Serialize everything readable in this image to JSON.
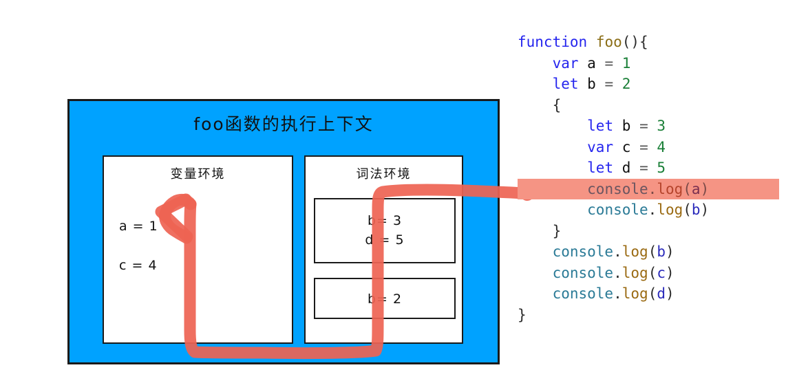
{
  "diagram": {
    "title": "foo函数的执行上下文",
    "variable_environment": {
      "title": "变量环境",
      "entries": [
        "a = 1",
        "c = 4"
      ]
    },
    "lexical_environment": {
      "title": "词法环境",
      "scopes": [
        {
          "lines": [
            "b= 3",
            "d = 5"
          ]
        },
        {
          "lines": [
            "b= 2"
          ]
        }
      ]
    },
    "colors": {
      "context_background": "#00A2FF",
      "box_border": "#1a1a1a",
      "annotation": "#EE6352",
      "highlight": "#F59484"
    }
  },
  "code": {
    "lines": [
      {
        "indent": 0,
        "highlight": false,
        "tokens": [
          {
            "t": "function",
            "c": "kw"
          },
          {
            "t": " ",
            "c": "punct"
          },
          {
            "t": "foo",
            "c": "fnname"
          },
          {
            "t": "(){",
            "c": "brace"
          }
        ]
      },
      {
        "indent": 1,
        "highlight": false,
        "tokens": [
          {
            "t": "var",
            "c": "kw"
          },
          {
            "t": " ",
            "c": "punct"
          },
          {
            "t": "a",
            "c": "var"
          },
          {
            "t": " ",
            "c": "punct"
          },
          {
            "t": "=",
            "c": "op"
          },
          {
            "t": " ",
            "c": "punct"
          },
          {
            "t": "1",
            "c": "num"
          }
        ]
      },
      {
        "indent": 1,
        "highlight": false,
        "tokens": [
          {
            "t": "let",
            "c": "kw"
          },
          {
            "t": " ",
            "c": "punct"
          },
          {
            "t": "b",
            "c": "var"
          },
          {
            "t": " ",
            "c": "punct"
          },
          {
            "t": "=",
            "c": "op"
          },
          {
            "t": " ",
            "c": "punct"
          },
          {
            "t": "2",
            "c": "num"
          }
        ]
      },
      {
        "indent": 1,
        "highlight": false,
        "tokens": [
          {
            "t": "{",
            "c": "brace"
          }
        ]
      },
      {
        "indent": 2,
        "highlight": false,
        "tokens": [
          {
            "t": "let",
            "c": "kw"
          },
          {
            "t": " ",
            "c": "punct"
          },
          {
            "t": "b",
            "c": "var"
          },
          {
            "t": " ",
            "c": "punct"
          },
          {
            "t": "=",
            "c": "op"
          },
          {
            "t": " ",
            "c": "punct"
          },
          {
            "t": "3",
            "c": "num"
          }
        ]
      },
      {
        "indent": 2,
        "highlight": false,
        "tokens": [
          {
            "t": "var",
            "c": "kw"
          },
          {
            "t": " ",
            "c": "punct"
          },
          {
            "t": "c",
            "c": "var"
          },
          {
            "t": " ",
            "c": "punct"
          },
          {
            "t": "=",
            "c": "op"
          },
          {
            "t": " ",
            "c": "punct"
          },
          {
            "t": "4",
            "c": "num"
          }
        ]
      },
      {
        "indent": 2,
        "highlight": false,
        "tokens": [
          {
            "t": "let",
            "c": "kw"
          },
          {
            "t": " ",
            "c": "punct"
          },
          {
            "t": "d",
            "c": "var"
          },
          {
            "t": " ",
            "c": "punct"
          },
          {
            "t": "=",
            "c": "op"
          },
          {
            "t": " ",
            "c": "punct"
          },
          {
            "t": "5",
            "c": "num"
          }
        ]
      },
      {
        "indent": 2,
        "highlight": true,
        "tokens": [
          {
            "t": "console",
            "c": "obj"
          },
          {
            "t": ".",
            "c": "punct"
          },
          {
            "t": "log",
            "c": "fn"
          },
          {
            "t": "(",
            "c": "punct"
          },
          {
            "t": "a",
            "c": "arg"
          },
          {
            "t": ")",
            "c": "punct"
          }
        ]
      },
      {
        "indent": 2,
        "highlight": false,
        "tokens": [
          {
            "t": "console",
            "c": "obj"
          },
          {
            "t": ".",
            "c": "punct"
          },
          {
            "t": "log",
            "c": "fn"
          },
          {
            "t": "(",
            "c": "punct"
          },
          {
            "t": "b",
            "c": "arg"
          },
          {
            "t": ")",
            "c": "punct"
          }
        ]
      },
      {
        "indent": 1,
        "highlight": false,
        "tokens": [
          {
            "t": "}",
            "c": "brace"
          }
        ]
      },
      {
        "indent": 1,
        "highlight": false,
        "tokens": [
          {
            "t": "console",
            "c": "obj"
          },
          {
            "t": ".",
            "c": "punct"
          },
          {
            "t": "log",
            "c": "fn"
          },
          {
            "t": "(",
            "c": "punct"
          },
          {
            "t": "b",
            "c": "arg"
          },
          {
            "t": ")",
            "c": "punct"
          }
        ]
      },
      {
        "indent": 1,
        "highlight": false,
        "tokens": [
          {
            "t": "console",
            "c": "obj"
          },
          {
            "t": ".",
            "c": "punct"
          },
          {
            "t": "log",
            "c": "fn"
          },
          {
            "t": "(",
            "c": "punct"
          },
          {
            "t": "c",
            "c": "arg"
          },
          {
            "t": ")",
            "c": "punct"
          }
        ]
      },
      {
        "indent": 1,
        "highlight": false,
        "tokens": [
          {
            "t": "console",
            "c": "obj"
          },
          {
            "t": ".",
            "c": "punct"
          },
          {
            "t": "log",
            "c": "fn"
          },
          {
            "t": "(",
            "c": "punct"
          },
          {
            "t": "d",
            "c": "arg"
          },
          {
            "t": ")",
            "c": "punct"
          }
        ]
      },
      {
        "indent": 0,
        "highlight": false,
        "tokens": [
          {
            "t": "}",
            "c": "brace"
          }
        ]
      }
    ]
  }
}
